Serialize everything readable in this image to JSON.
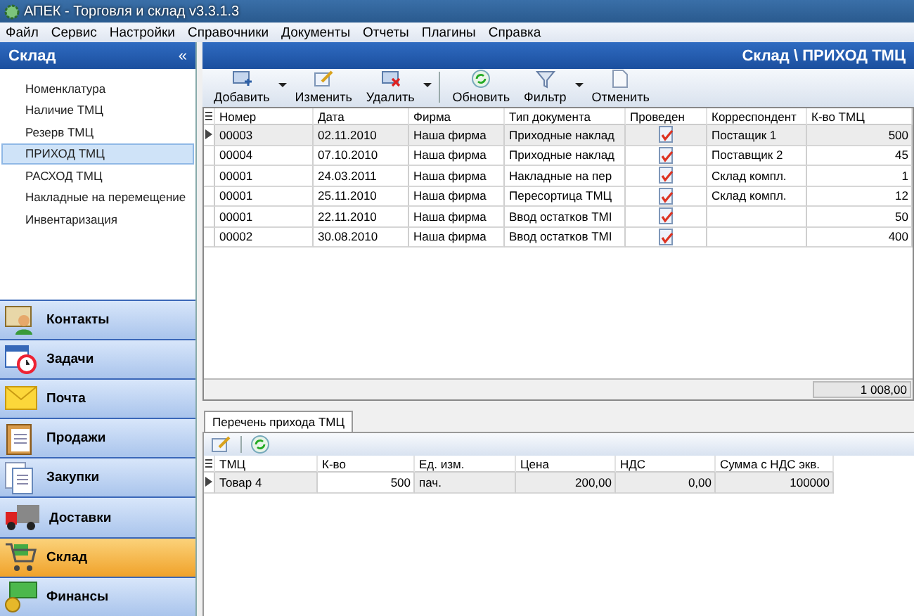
{
  "window": {
    "title": "АПЕК - Торговля и склад v3.3.1.3"
  },
  "menu": [
    "Файл",
    "Сервис",
    "Настройки",
    "Справочники",
    "Документы",
    "Отчеты",
    "Плагины",
    "Справка"
  ],
  "sidebar": {
    "title": "Склад",
    "collapse": "«",
    "items": [
      {
        "label": "Номенклатура",
        "selected": false
      },
      {
        "label": "Наличие ТМЦ",
        "selected": false
      },
      {
        "label": "Резерв ТМЦ",
        "selected": false
      },
      {
        "label": "ПРИХОД ТМЦ",
        "selected": true
      },
      {
        "label": "РАСХОД ТМЦ",
        "selected": false
      },
      {
        "label": "Накладные на перемещение",
        "selected": false
      },
      {
        "label": "Инвентаризация",
        "selected": false
      }
    ],
    "modules": [
      {
        "label": "Контакты",
        "selected": false
      },
      {
        "label": "Задачи",
        "selected": false
      },
      {
        "label": "Почта",
        "selected": false
      },
      {
        "label": "Продажи",
        "selected": false
      },
      {
        "label": "Закупки",
        "selected": false
      },
      {
        "label": "Доставки",
        "selected": false
      },
      {
        "label": "Склад",
        "selected": true
      },
      {
        "label": "Финансы",
        "selected": false
      }
    ]
  },
  "header": {
    "title": "Склад \\ ПРИХОД ТМЦ"
  },
  "toolbar": [
    {
      "kind": "add",
      "label": "Добавить",
      "dropdown": true
    },
    {
      "kind": "edit",
      "label": "Изменить",
      "dropdown": false
    },
    {
      "kind": "delete",
      "label": "Удалить",
      "dropdown": true
    },
    {
      "kind": "separator"
    },
    {
      "kind": "refresh",
      "label": "Обновить",
      "dropdown": false
    },
    {
      "kind": "filter",
      "label": "Фильтр",
      "dropdown": true
    },
    {
      "kind": "cancel",
      "label": "Отменить",
      "dropdown": false
    }
  ],
  "table": {
    "columns": [
      "Номер",
      "Дата",
      "Фирма",
      "Тип документа",
      "Проведен",
      "Корреспондент",
      "К-во ТМЦ"
    ],
    "rows": [
      {
        "selected": true,
        "number": "00003",
        "date": "02.11.2010",
        "firm": "Наша фирма",
        "type": "Приходные наклад",
        "posted": true,
        "correspondent": "Постащик 1",
        "qty": "500"
      },
      {
        "selected": false,
        "number": "00004",
        "date": "07.10.2010",
        "firm": "Наша фирма",
        "type": "Приходные наклад",
        "posted": true,
        "correspondent": "Поставщик 2",
        "qty": "45"
      },
      {
        "selected": false,
        "number": "00001",
        "date": "24.03.2011",
        "firm": "Наша фирма",
        "type": "Накладные на пер",
        "posted": true,
        "correspondent": "Склад компл.",
        "qty": "1"
      },
      {
        "selected": false,
        "number": "00001",
        "date": "25.11.2010",
        "firm": "Наша фирма",
        "type": "Пересортица ТМЦ",
        "posted": true,
        "correspondent": "Склад компл.",
        "qty": "12"
      },
      {
        "selected": false,
        "number": "00001",
        "date": "22.11.2010",
        "firm": "Наша фирма",
        "type": "Ввод остатков ТМI",
        "posted": true,
        "correspondent": "",
        "qty": "50"
      },
      {
        "selected": false,
        "number": "00002",
        "date": "30.08.2010",
        "firm": "Наша фирма",
        "type": "Ввод остатков ТМI",
        "posted": true,
        "correspondent": "",
        "qty": "400"
      }
    ],
    "total": "1 008,00"
  },
  "detail": {
    "tabs": [
      {
        "label": "Перечень прихода ТМЦ",
        "selected": true
      }
    ],
    "columns": [
      "ТМЦ",
      "К-во",
      "Ед. изм.",
      "Цена",
      "НДС",
      "Сумма с НДС экв."
    ],
    "rows": [
      {
        "selected": true,
        "item": "Товар 4",
        "qty": "500",
        "unit": "пач.",
        "price": "200,00",
        "vat": "0,00",
        "sum": "100000"
      }
    ]
  }
}
